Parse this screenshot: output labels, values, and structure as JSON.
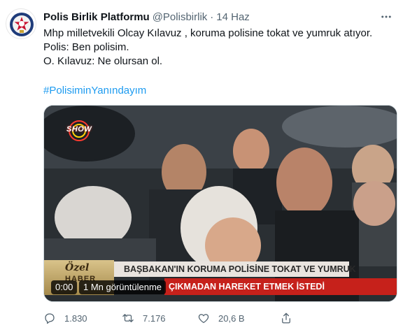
{
  "tweet": {
    "display_name": "Polis Birlik Platformu",
    "handle": "@Polisbirlik",
    "separator": "·",
    "time": "14 Haz",
    "lines": [
      "Mhp milletvekili Olcay Kılavuz , koruma polisine tokat ve yumruk atıyor.",
      "Polis: Ben polisim.",
      "O. Kılavuz: Ne olursan ol."
    ],
    "hashtag": "#PolisiminYanındayım",
    "avatar_icon": "police-badge-icon",
    "more_icon": "more-icon"
  },
  "video": {
    "channel": "SHOW",
    "badge_top": "Özel",
    "badge_bottom": "HABER",
    "headline_top": "BAŞBAKAN'IN KORUMA POLİSİNE TOKAT VE YUMRUK",
    "headline_bottom": "ÇIKMADAN HAREKET ETMEK İSTEDİ",
    "time": "0:00",
    "views": "1 Mn görüntülenme"
  },
  "actions": {
    "reply": {
      "icon": "reply-icon",
      "count": "1.830"
    },
    "retweet": {
      "icon": "retweet-icon",
      "count": "7.176"
    },
    "like": {
      "icon": "like-icon",
      "count": "20,6 B"
    },
    "share": {
      "icon": "share-icon"
    }
  },
  "colors": {
    "accent": "#1d9bf0",
    "muted": "#536471",
    "text": "#0f1419",
    "news_red": "#c6211b"
  }
}
